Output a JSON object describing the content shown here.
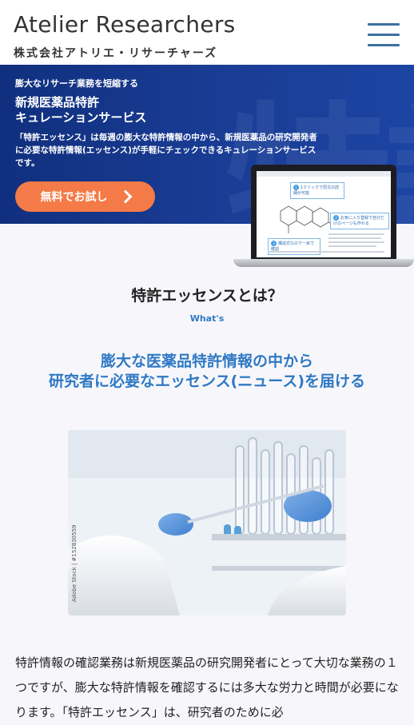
{
  "header": {
    "logo_title": "Atelier Researchers",
    "logo_subtitle": "株式会社アトリエ・リサーチャーズ",
    "menu_icon": "hamburger-menu-icon"
  },
  "hero": {
    "kicker": "膨大なリサーチ業務を短縮する",
    "title_line1": "新規医薬品特許",
    "title_line2": "キュレーションサービス",
    "description": "「特許エッセンス」は毎週の膨大な特許情報の中から、新規医薬品の研究開発者に必要な特許情報(エッセンス)が手軽にチェックできるキュレーションサービスです。",
    "cta_label": "無料でお試し",
    "cta_icon": "chevron-right-icon",
    "laptop": {
      "callout1": "1クリックで原文の詳細が可能",
      "callout2": "お気に入り登録で自分だけのページも作れる",
      "callout3": "構造式なので一目で確認"
    }
  },
  "section": {
    "title": "特許エッセンスとは？",
    "subtitle": "What's",
    "lead_line1": "膨大な医薬品特許情報の中から",
    "lead_line2": "研究者に必要なエッセンス(ニュース)を届ける",
    "photo_watermark": "Adobe Stock | #152830559",
    "body": "特許情報の確認業務は新規医薬品の研究開発者にとって大切な業務の１つですが、膨大な特許情報を確認するには多大な労力と時間が必要になります。「特許エッセンス」は、研究者のために必"
  },
  "colors": {
    "accent_blue": "#2f79c4",
    "hero_blue": "#1a3d95",
    "cta_orange": "#f47a47",
    "menu_blue": "#3d6f9f"
  }
}
